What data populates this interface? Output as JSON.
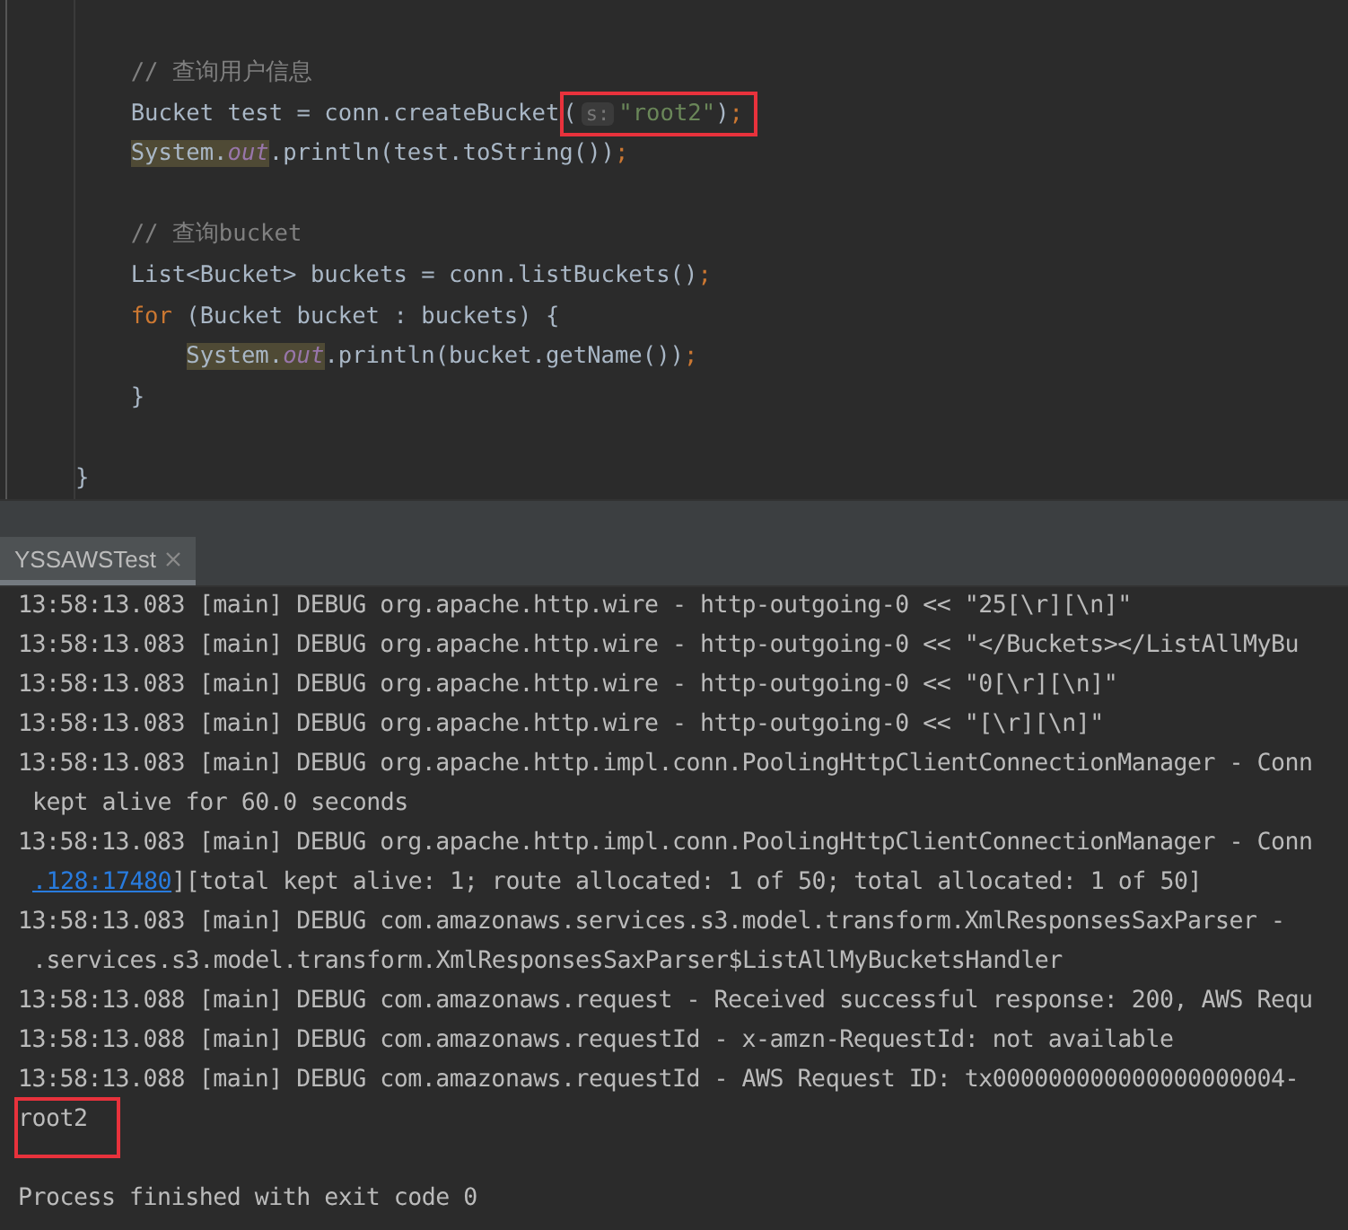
{
  "editor": {
    "lines": [
      {
        "tokens": [
          {
            "text": "// 查询用户信息",
            "kind": "comment"
          }
        ]
      },
      {
        "tokens": [
          {
            "text": "Bucket test = conn.createBucket",
            "kind": "plain"
          },
          {
            "kind": "group",
            "boxed": true,
            "tokens": [
              {
                "text": "(",
                "kind": "plain"
              },
              {
                "text": "s:",
                "kind": "hint"
              },
              {
                "text": "\"root2\"",
                "kind": "string"
              },
              {
                "text": ")",
                "kind": "plain"
              },
              {
                "text": ";",
                "kind": "punct"
              }
            ]
          }
        ]
      },
      {
        "tokens": [
          {
            "text": "System.",
            "kind": "plain",
            "marked": true
          },
          {
            "text": "out",
            "kind": "field",
            "marked": true
          },
          {
            "text": ".println(test.toString())",
            "kind": "plain"
          },
          {
            "text": ";",
            "kind": "punct"
          }
        ]
      },
      {
        "gap_before": true,
        "tokens": [
          {
            "text": "// 查询bucket",
            "kind": "comment"
          }
        ]
      },
      {
        "tokens": [
          {
            "text": "List<Bucket> buckets = conn.listBuckets()",
            "kind": "plain"
          },
          {
            "text": ";",
            "kind": "punct"
          }
        ]
      },
      {
        "tokens": [
          {
            "text": "for",
            "kind": "keyword"
          },
          {
            "text": " (Bucket bucket : buckets) {",
            "kind": "plain"
          }
        ],
        "children": [
          {
            "tokens": [
              {
                "text": "System.",
                "kind": "plain",
                "marked": true
              },
              {
                "text": "out",
                "kind": "field",
                "marked": true
              },
              {
                "text": ".println(bucket.getName())",
                "kind": "plain"
              },
              {
                "text": ";",
                "kind": "punct"
              }
            ]
          }
        ]
      },
      {
        "tokens": [
          {
            "text": "}",
            "kind": "plain"
          }
        ]
      }
    ],
    "closing": {
      "gap_before": true,
      "tokens": [
        {
          "text": "}",
          "kind": "plain"
        }
      ]
    }
  },
  "console": {
    "tabs": [
      {
        "label": "YSSAWSTest",
        "selected": true
      }
    ],
    "lines": [
      {
        "kind": "log",
        "text": "13:58:13.083 [main] DEBUG org.apache.http.wire - http-outgoing-0 << \"25[\\r][\\n]\""
      },
      {
        "kind": "log",
        "text": "13:58:13.083 [main] DEBUG org.apache.http.wire - http-outgoing-0 << \"</Buckets></ListAllMyBu"
      },
      {
        "kind": "log",
        "text": "13:58:13.083 [main] DEBUG org.apache.http.wire - http-outgoing-0 << \"0[\\r][\\n]\""
      },
      {
        "kind": "log",
        "text": "13:58:13.083 [main] DEBUG org.apache.http.wire - http-outgoing-0 << \"[\\r][\\n]\""
      },
      {
        "kind": "log",
        "text": "13:58:13.083 [main] DEBUG org.apache.http.impl.conn.PoolingHttpClientConnectionManager - Conn"
      },
      {
        "kind": "wrap",
        "text": "kept alive for 60.0 seconds"
      },
      {
        "kind": "log",
        "text": "13:58:13.083 [main] DEBUG org.apache.http.impl.conn.PoolingHttpClientConnectionManager - Conn"
      },
      {
        "kind": "wrap",
        "link": ".128:17480",
        "text": "][total kept alive: 1; route allocated: 1 of 50; total allocated: 1 of 50]"
      },
      {
        "kind": "log",
        "text": "13:58:13.083 [main] DEBUG com.amazonaws.services.s3.model.transform.XmlResponsesSaxParser -"
      },
      {
        "kind": "wrap",
        "text": ".services.s3.model.transform.XmlResponsesSaxParser$ListAllMyBucketsHandler"
      },
      {
        "kind": "log",
        "text": "13:58:13.088 [main] DEBUG com.amazonaws.request - Received successful response: 200, AWS Requ"
      },
      {
        "kind": "log",
        "text": "13:58:13.088 [main] DEBUG com.amazonaws.requestId - x-amzn-RequestId: not available"
      },
      {
        "kind": "log",
        "text": "13:58:13.088 [main] DEBUG com.amazonaws.requestId - AWS Request ID: tx000000000000000000004-"
      },
      {
        "kind": "output",
        "text": "root2",
        "highlighted": true
      },
      {
        "kind": "exit",
        "text": "Process finished with exit code 0"
      }
    ]
  }
}
